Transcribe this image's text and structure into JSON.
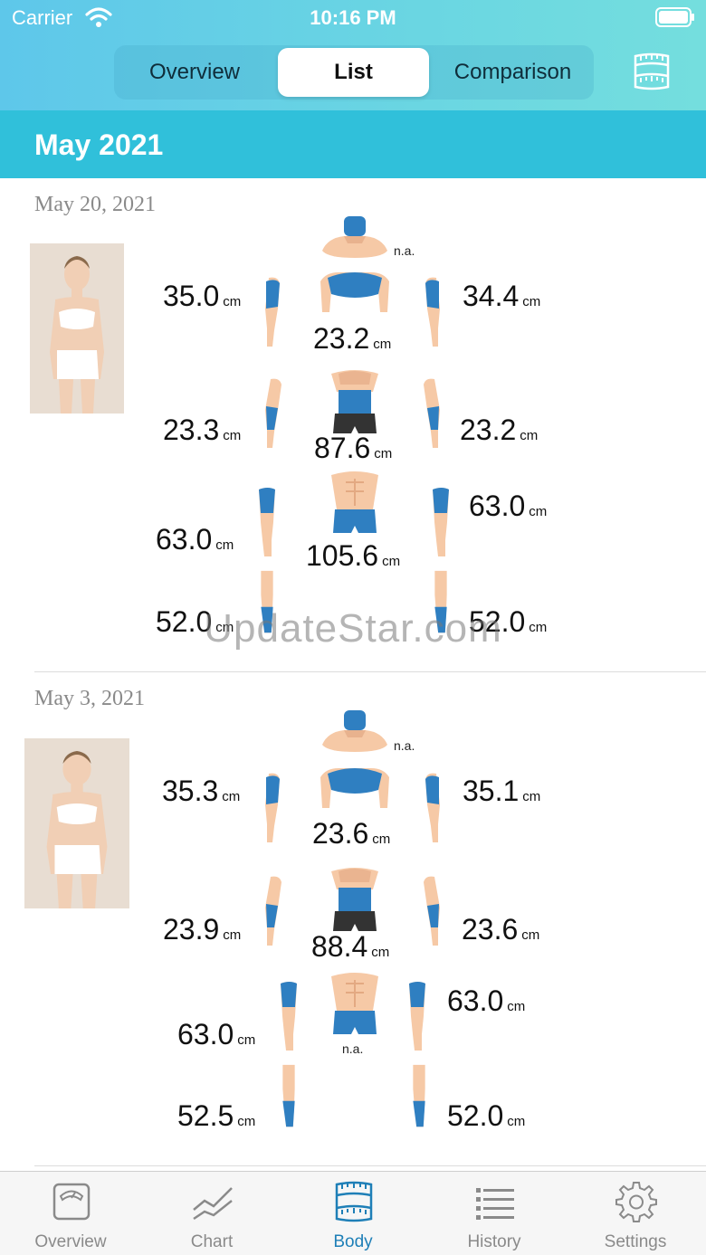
{
  "status_bar": {
    "carrier": "Carrier",
    "time": "10:16 PM"
  },
  "segments": {
    "overview": "Overview",
    "list": "List",
    "comparison": "Comparison",
    "selected": "List"
  },
  "month": "May 2021",
  "entries": [
    {
      "date": "May 20, 2021",
      "neck": "n.a.",
      "left_upper_arm": "35.0",
      "right_upper_arm": "34.4",
      "chest": "23.2",
      "left_forearm": "23.3",
      "right_forearm": "23.2",
      "waist": "87.6",
      "hips": "105.6",
      "left_thigh": "63.0",
      "right_thigh": "63.0",
      "left_calf": "52.0",
      "right_calf": "52.0",
      "unit": "cm"
    },
    {
      "date": "May 3, 2021",
      "neck": "n.a.",
      "left_upper_arm": "35.3",
      "right_upper_arm": "35.1",
      "chest": "23.6",
      "left_forearm": "23.9",
      "right_forearm": "23.6",
      "waist": "88.4",
      "hips": "n.a.",
      "left_thigh": "63.0",
      "right_thigh": "63.0",
      "left_calf": "52.5",
      "right_calf": "52.0",
      "unit": "cm"
    }
  ],
  "watermark": "UpdateStar.com",
  "tabs": [
    {
      "label": "Overview",
      "icon": "scale-icon"
    },
    {
      "label": "Chart",
      "icon": "chart-icon"
    },
    {
      "label": "Body",
      "icon": "tape-measure-icon",
      "active": true
    },
    {
      "label": "History",
      "icon": "list-icon"
    },
    {
      "label": "Settings",
      "icon": "gear-icon"
    }
  ],
  "colors": {
    "header": "#5ec7ea",
    "month_bar": "#30c0da",
    "highlight": "#2f7fc1",
    "skin": "#f6c9a6",
    "active_tab": "#1e7fb7"
  }
}
